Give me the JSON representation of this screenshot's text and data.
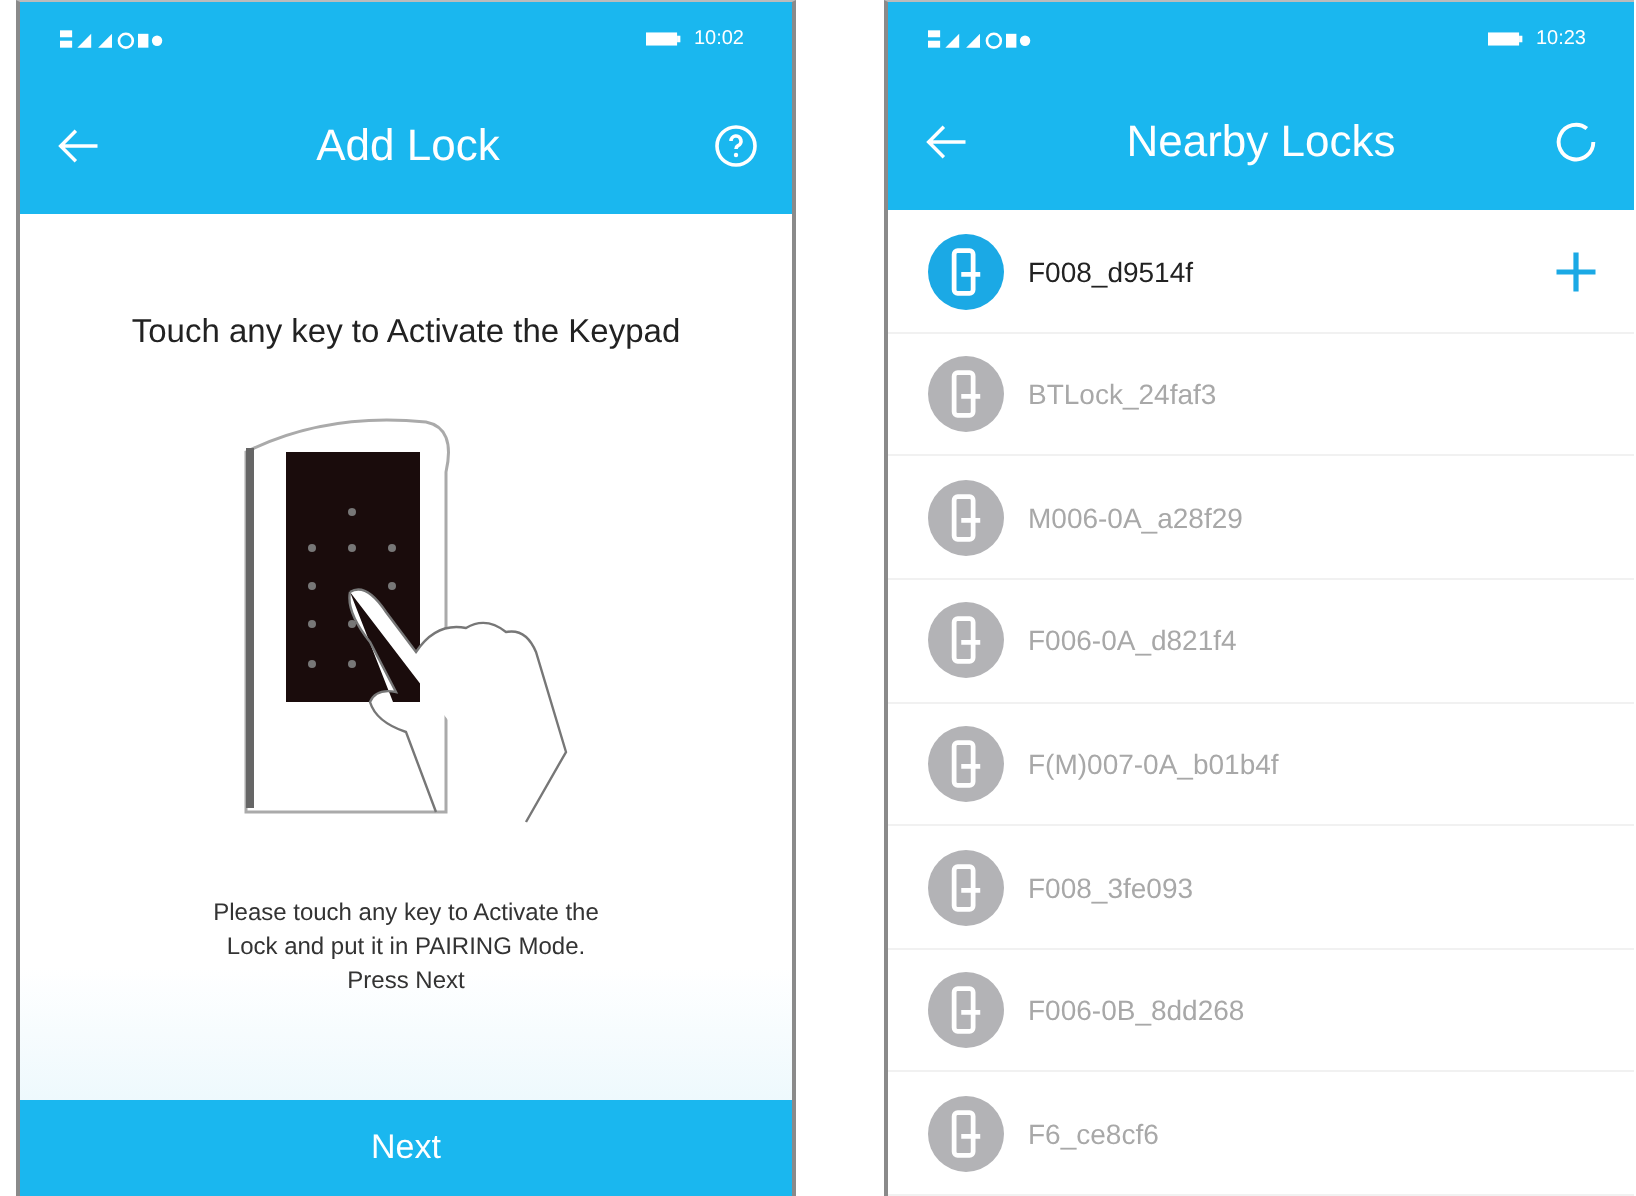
{
  "screens": [
    {
      "kind": "add_lock",
      "status_bar": {
        "time": "10:02"
      },
      "title": "Add Lock",
      "heading": "Touch any key to Activate the Keypad",
      "instructions": [
        "Please touch any key to Activate the",
        "Lock and put it in PAIRING Mode.",
        "Press Next"
      ],
      "next_button": "Next"
    },
    {
      "kind": "nearby_locks",
      "status_bar": {
        "time": "10:23"
      },
      "title": "Nearby Locks",
      "locks": [
        {
          "name": "F008_d9514f",
          "active": true
        },
        {
          "name": "BTLock_24faf3",
          "active": false
        },
        {
          "name": "M006-0A_a28f29",
          "active": false
        },
        {
          "name": "F006-0A_d821f4",
          "active": false
        },
        {
          "name": "F(M)007-0A_b01b4f",
          "active": false
        },
        {
          "name": "F008_3fe093",
          "active": false
        },
        {
          "name": "F006-0B_8dd268",
          "active": false
        },
        {
          "name": "F6_ce8cf6",
          "active": false
        }
      ]
    }
  ]
}
